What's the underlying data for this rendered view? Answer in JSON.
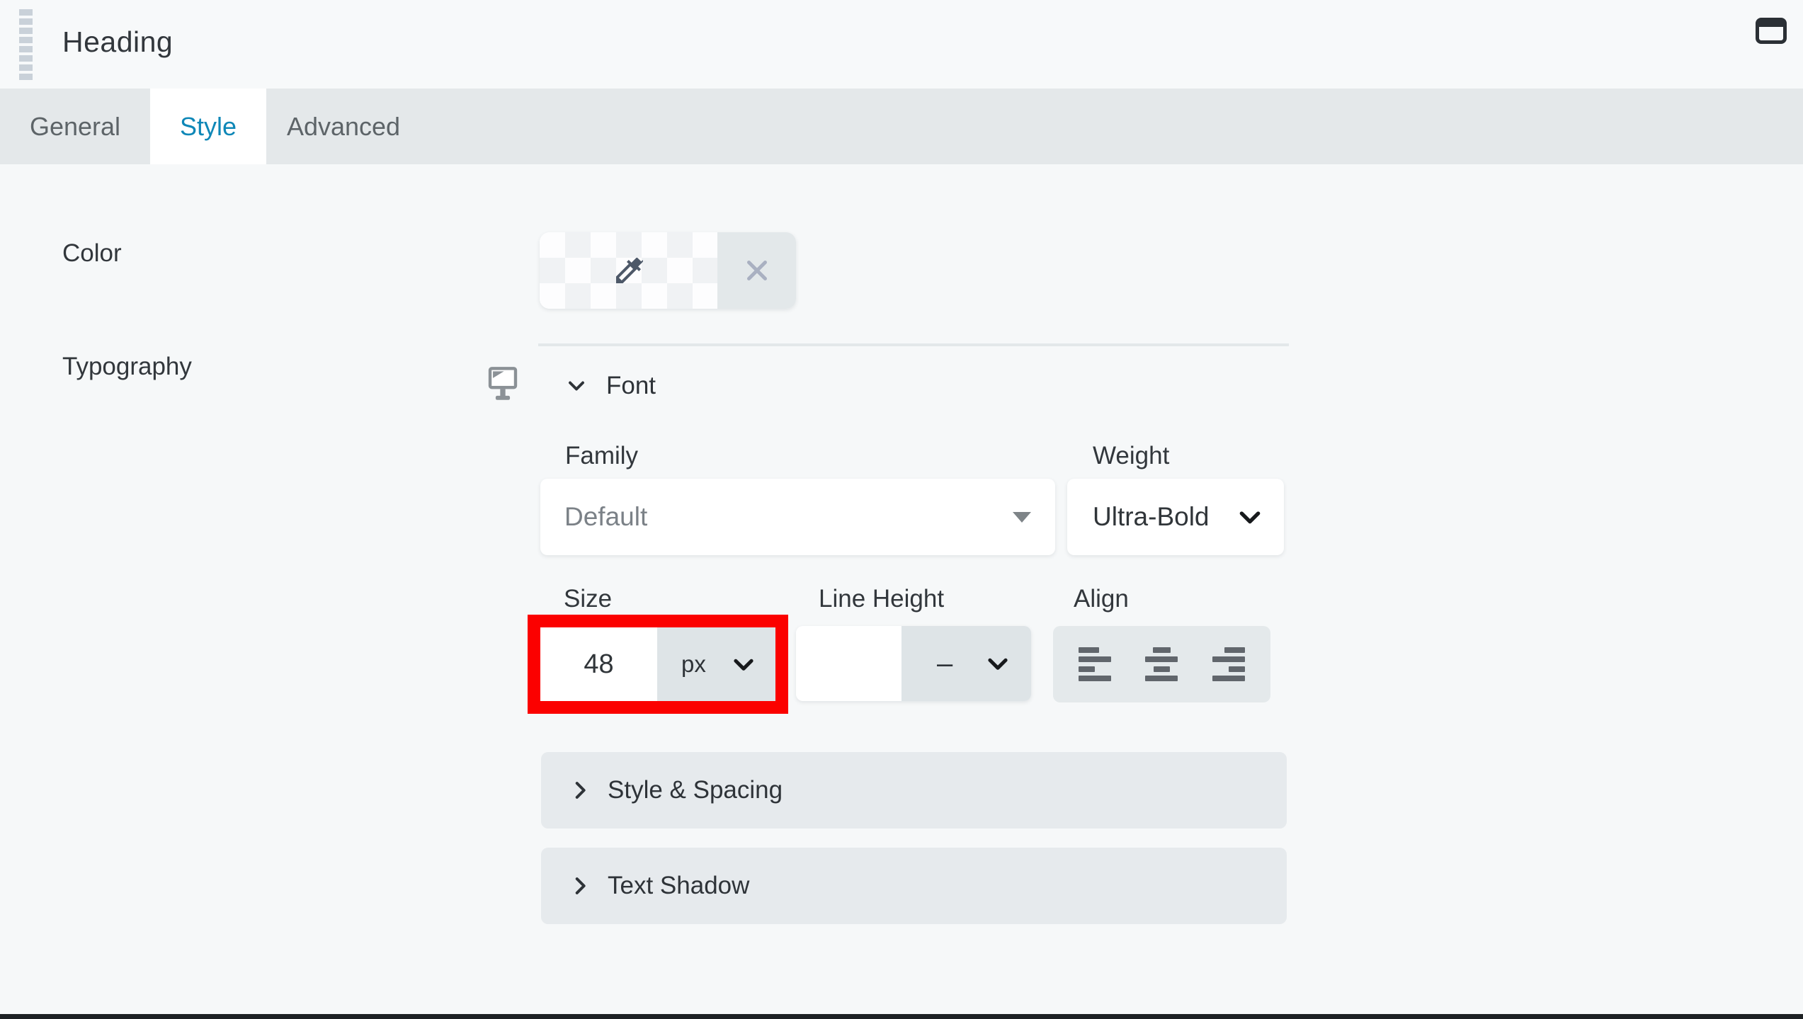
{
  "window": {
    "title": "Heading"
  },
  "tabs": [
    {
      "label": "General",
      "active": false
    },
    {
      "label": "Style",
      "active": true
    },
    {
      "label": "Advanced",
      "active": false
    }
  ],
  "panel": {
    "color": {
      "label": "Color"
    },
    "typography": {
      "label": "Typography",
      "font_section": {
        "title": "Font",
        "family": {
          "label": "Family",
          "value": "Default"
        },
        "weight": {
          "label": "Weight",
          "value": "Ultra-Bold"
        },
        "size": {
          "label": "Size",
          "value": "48",
          "unit": "px"
        },
        "line_height": {
          "label": "Line Height",
          "value": "",
          "unit": "–"
        },
        "align": {
          "label": "Align"
        }
      },
      "collapsed_sections": [
        {
          "title": "Style & Spacing"
        },
        {
          "title": "Text Shadow"
        }
      ]
    }
  },
  "colors": {
    "active_tab_accent": "#0e87b7",
    "annotation_highlight": "#fb0100",
    "tab_bar": "#e4e8ea",
    "control_gray": "#dee4e7",
    "section_bar": "#e6eaed"
  },
  "icons": {
    "drag_handle": "drag-handle",
    "window_toggle": "window",
    "transparent_swatch": "checkerboard",
    "pick_color": "eyedropper",
    "clear_color": "x",
    "responsive_toggle": "monitor",
    "expanded_section": "chevron-down",
    "collapsed_section": "chevron-right",
    "family_arrow": "triangle-down",
    "select_arrow": "chevron-down",
    "align_options": [
      "align-left",
      "align-center",
      "align-right"
    ]
  }
}
